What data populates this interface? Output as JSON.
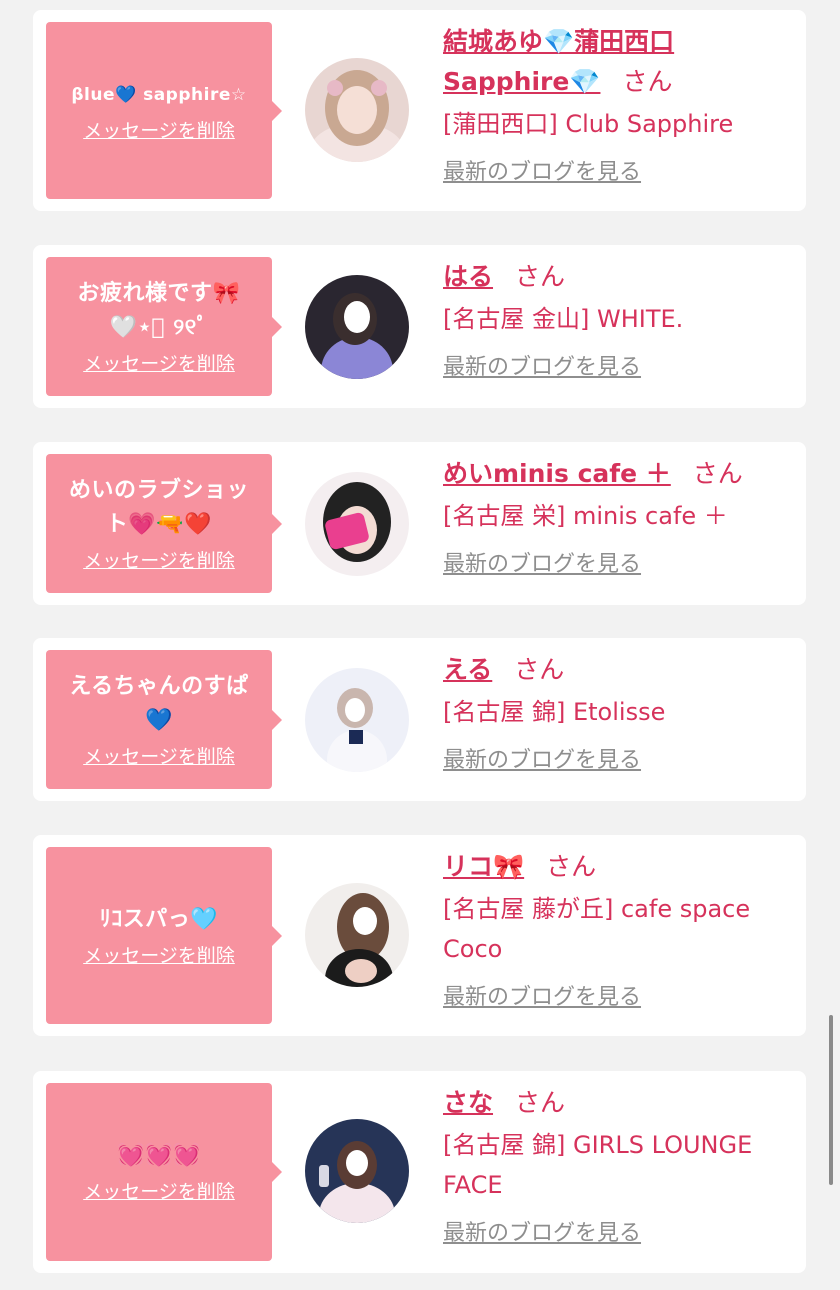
{
  "cards": [
    {
      "message": "βlue💙 sapphire☆",
      "delete_label": "メッセージを削除",
      "name": "結城あゆ💎蒲田西口Sapphire💎",
      "name_line1": "結城あゆ💎蒲田西口",
      "name_line2": "Sapphire💎",
      "honorific": "さん",
      "shop": "[蒲田西口] Club Sapphire",
      "blog_link": "最新のブログを見る"
    },
    {
      "message": "お疲れ様です🎀🤍⋆͛ ｡ﾟ ୨୧",
      "message_line1": "お疲れ様です🎀",
      "message_line2": "🤍⋆͛ ୨୧ﾟ",
      "delete_label": "メッセージを削除",
      "name": "はる",
      "honorific": "さん",
      "shop": "[名古屋 金山] WHITE.",
      "blog_link": "最新のブログを見る"
    },
    {
      "message": "めいのラブショット💗🔫❤️",
      "message_line1": "めいのラブショッ",
      "message_line2": "ト💗🔫❤️",
      "delete_label": "メッセージを削除",
      "name": "めいminis cafe ＋",
      "honorific": "さん",
      "shop": "[名古屋 栄] minis cafe ＋",
      "blog_link": "最新のブログを見る"
    },
    {
      "message": "えるちゃんのすぱ💙",
      "message_line1": "えるちゃんのすぱ",
      "message_line2": "💙",
      "delete_label": "メッセージを削除",
      "name": "える",
      "honorific": "さん",
      "shop": "[名古屋 錦] Etolisse",
      "blog_link": "最新のブログを見る"
    },
    {
      "message": "ﾘｺスパっ🩵",
      "delete_label": "メッセージを削除",
      "name": "リコ🎀",
      "honorific": "さん",
      "shop": "[名古屋 藤が丘] cafe space Coco",
      "shop_line1": "[名古屋 藤が丘] cafe space",
      "shop_line2": "Coco",
      "blog_link": "最新のブログを見る"
    },
    {
      "message": "💓💓💓",
      "delete_label": "メッセージを削除",
      "name": "さな",
      "honorific": "さん",
      "shop": "[名古屋 錦] GIRLS LOUNGE FACE",
      "shop_line1": "[名古屋 錦] GIRLS LOUNGE",
      "shop_line2": "FACE",
      "blog_link": "最新のブログを見る"
    }
  ]
}
